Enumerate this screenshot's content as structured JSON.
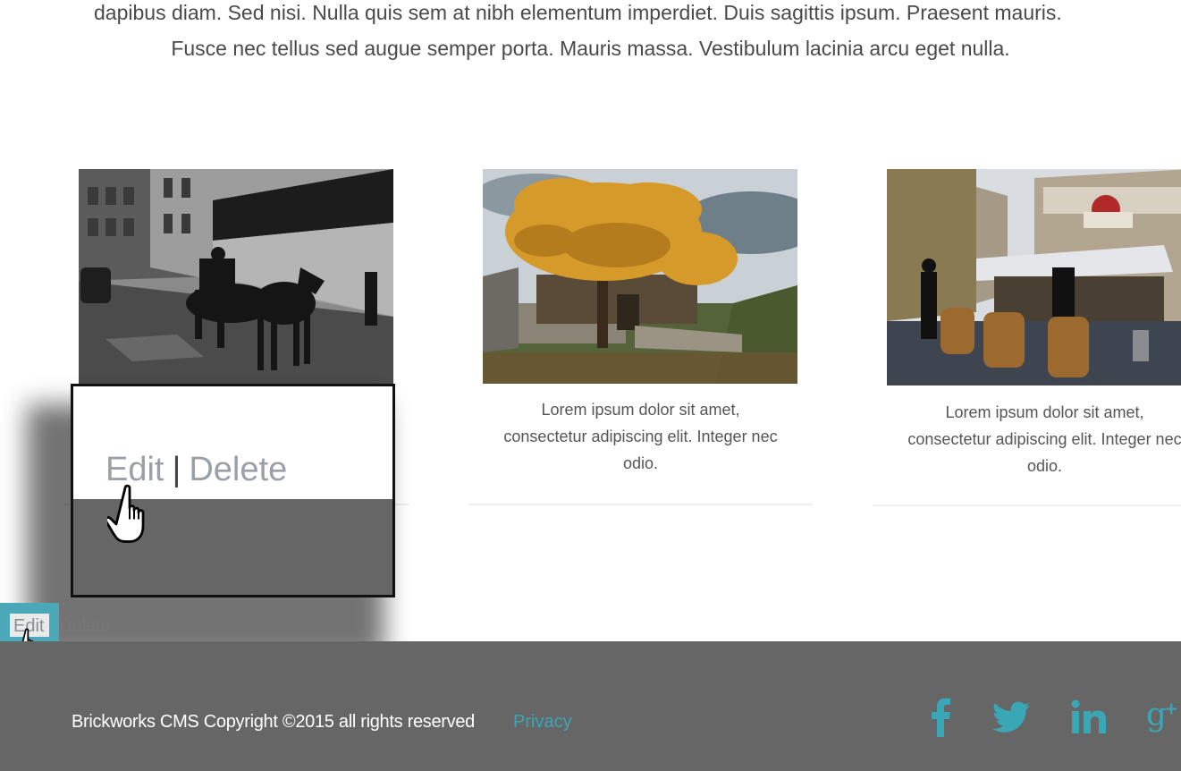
{
  "intro": {
    "line1": "dapibus diam. Sed nisi. Nulla quis sem at nibh elementum imperdiet. Duis sagittis ipsum. Praesent mauris.",
    "line2": "Fusce nec tellus sed augue semper porta. Mauris massa. Vestibulum lacinia arcu eget nulla."
  },
  "cards": [
    {
      "caption_1": "",
      "caption_2": "",
      "caption_3": ""
    },
    {
      "caption_1": "Lorem ipsum dolor sit amet,",
      "caption_2": "consectetur adipiscing elit. Integer nec",
      "caption_3": "odio."
    },
    {
      "caption_1": "Lorem ipsum dolor sit amet,",
      "caption_2": "consectetur adipiscing elit. Integer nec",
      "caption_3": "odio."
    }
  ],
  "popup": {
    "edit_label": "Edit",
    "separator": "|",
    "delete_label": "Delete"
  },
  "small_actions": {
    "edit_label": "Edit",
    "delete_label": "Delete"
  },
  "footer": {
    "copyright": "Brickworks CMS Copyright ©2015 all rights reserved",
    "privacy_label": "Privacy",
    "social": [
      "facebook-icon",
      "twitter-icon",
      "linkedin-icon",
      "google-plus-icon"
    ]
  },
  "colors": {
    "accent": "#3aa7b7",
    "footer_bg": "#666666",
    "popup_bottom": "#666666"
  }
}
